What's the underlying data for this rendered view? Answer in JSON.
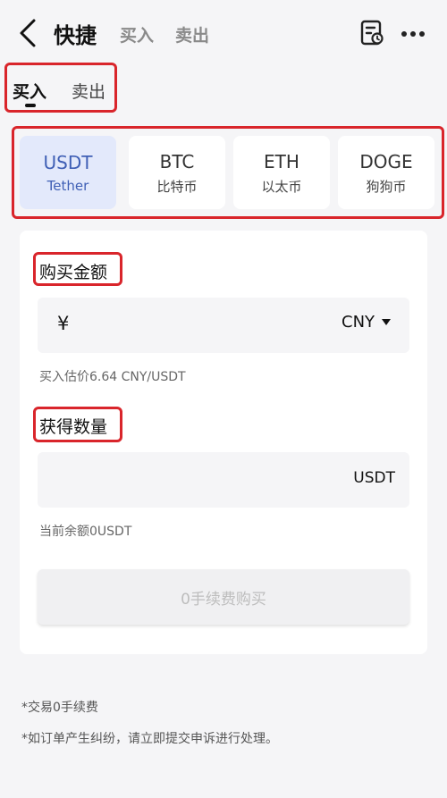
{
  "header": {
    "title": "快捷",
    "tab_buy": "买入",
    "tab_sell": "卖出"
  },
  "sub_tabs": {
    "buy": "买入",
    "sell": "卖出"
  },
  "coins": [
    {
      "symbol": "USDT",
      "name": "Tether",
      "active": true
    },
    {
      "symbol": "BTC",
      "name": "比特币",
      "active": false
    },
    {
      "symbol": "ETH",
      "name": "以太币",
      "active": false
    },
    {
      "symbol": "DOGE",
      "name": "狗狗币",
      "active": false
    }
  ],
  "buy_form": {
    "amount_label": "购买金额",
    "currency_symbol": "¥",
    "amount_value": "",
    "amount_unit": "CNY",
    "rate_hint": "买入估价6.64 CNY/USDT",
    "receive_label": "获得数量",
    "receive_value": "",
    "receive_unit": "USDT",
    "balance_hint": "当前余额0USDT",
    "submit_label": "0手续费购买"
  },
  "notes": {
    "fee": "*交易0手续费",
    "dispute": "*如订单产生纠纷，请立即提交申诉进行处理。"
  },
  "colors": {
    "accent_blue": "#3f5fb5",
    "active_coin_bg": "#e3e9fb",
    "annotation_red": "#d9252b",
    "page_bg": "#f5f5f7"
  },
  "icons": [
    "back-icon",
    "orders-icon",
    "more-icon",
    "caret-down-icon"
  ]
}
